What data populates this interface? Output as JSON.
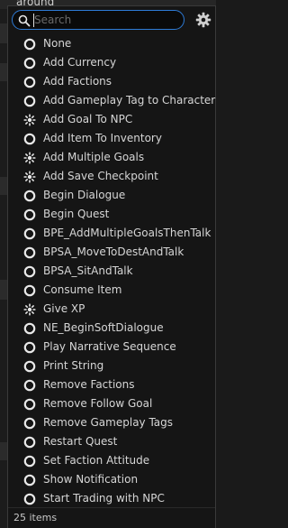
{
  "background": {
    "top_text": "around"
  },
  "search": {
    "placeholder": "Search",
    "value": ""
  },
  "settings": {
    "icon": "gear-icon"
  },
  "items": [
    {
      "label": "None",
      "icon": "radio-circle-icon"
    },
    {
      "label": "Add Currency",
      "icon": "radio-circle-icon"
    },
    {
      "label": "Add Factions",
      "icon": "radio-circle-icon"
    },
    {
      "label": "Add Gameplay Tag to Character",
      "icon": "radio-circle-icon"
    },
    {
      "label": "Add Goal To NPC",
      "icon": "blueprint-icon"
    },
    {
      "label": "Add Item To Inventory",
      "icon": "radio-circle-icon"
    },
    {
      "label": "Add Multiple Goals",
      "icon": "blueprint-icon"
    },
    {
      "label": "Add Save Checkpoint",
      "icon": "blueprint-icon"
    },
    {
      "label": "Begin Dialogue",
      "icon": "radio-circle-icon"
    },
    {
      "label": "Begin Quest",
      "icon": "radio-circle-icon"
    },
    {
      "label": "BPE_AddMultipleGoalsThenTalk",
      "icon": "radio-circle-icon"
    },
    {
      "label": "BPSA_MoveToDestAndTalk",
      "icon": "radio-circle-icon"
    },
    {
      "label": "BPSA_SitAndTalk",
      "icon": "radio-circle-icon"
    },
    {
      "label": "Consume Item",
      "icon": "radio-circle-icon"
    },
    {
      "label": "Give XP",
      "icon": "blueprint-icon"
    },
    {
      "label": "NE_BeginSoftDialogue",
      "icon": "radio-circle-icon"
    },
    {
      "label": "Play Narrative Sequence",
      "icon": "radio-circle-icon"
    },
    {
      "label": "Print String",
      "icon": "radio-circle-icon"
    },
    {
      "label": "Remove Factions",
      "icon": "radio-circle-icon"
    },
    {
      "label": "Remove Follow Goal",
      "icon": "radio-circle-icon"
    },
    {
      "label": "Remove Gameplay Tags",
      "icon": "radio-circle-icon"
    },
    {
      "label": "Restart Quest",
      "icon": "radio-circle-icon"
    },
    {
      "label": "Set Faction Attitude",
      "icon": "radio-circle-icon"
    },
    {
      "label": "Show Notification",
      "icon": "radio-circle-icon"
    },
    {
      "label": "Start Trading with NPC",
      "icon": "radio-circle-icon"
    }
  ],
  "footer": {
    "count_text": "25 items"
  },
  "colors": {
    "panel_bg": "#151515",
    "search_border": "#2e7bd6",
    "text": "#d6d6d6"
  }
}
